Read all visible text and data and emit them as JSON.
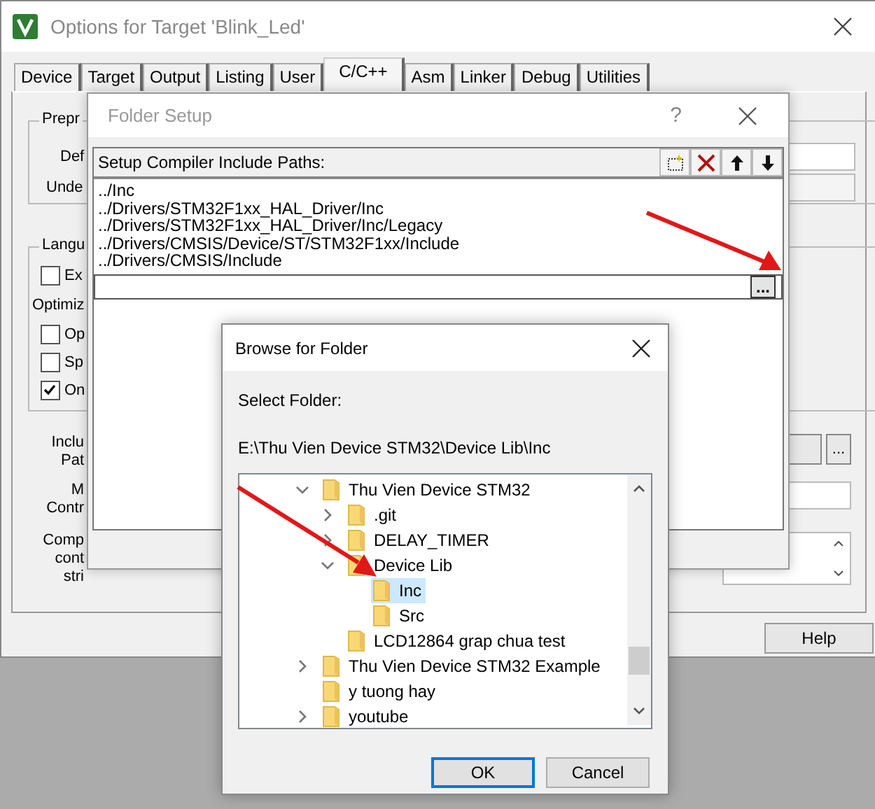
{
  "main_window": {
    "title": "Options for Target 'Blink_Led'",
    "tabs": [
      {
        "label": "Device",
        "selected": false
      },
      {
        "label": "Target",
        "selected": false
      },
      {
        "label": "Output",
        "selected": false
      },
      {
        "label": "Listing",
        "selected": false
      },
      {
        "label": "User",
        "selected": false
      },
      {
        "label": "C/C++",
        "selected": true
      },
      {
        "label": "Asm",
        "selected": false
      },
      {
        "label": "Linker",
        "selected": false
      },
      {
        "label": "Debug",
        "selected": false
      },
      {
        "label": "Utilities",
        "selected": false
      }
    ],
    "preprocessor_group": {
      "label": "Prepr",
      "fields": [
        {
          "label": "Def"
        },
        {
          "label": "Unde"
        }
      ]
    },
    "language_group": {
      "label": "Langu",
      "items": [
        {
          "kind": "checkbox",
          "label": "Ex",
          "checked": false
        },
        {
          "kind": "label",
          "label": "Optimiz"
        },
        {
          "kind": "checkbox",
          "label": "Op",
          "checked": false
        },
        {
          "kind": "checkbox",
          "label": "Sp",
          "checked": false
        },
        {
          "kind": "checkbox",
          "label": "On",
          "checked": true
        }
      ]
    },
    "include_paths_label": [
      "Inclu",
      "Pat"
    ],
    "include_paths_browse": "...",
    "misc_controls_label": [
      "M",
      "Contr"
    ],
    "compiler_string_label": [
      "Comp",
      "cont",
      "stri"
    ],
    "help_button": "Help"
  },
  "folder_setup": {
    "title": "Folder Setup",
    "help": "?",
    "header": "Setup Compiler Include Paths:",
    "paths": [
      "../Inc",
      "../Drivers/STM32F1xx_HAL_Driver/Inc",
      "../Drivers/STM32F1xx_HAL_Driver/Inc/Legacy",
      "../Drivers/CMSIS/Device/ST/STM32F1xx/Include",
      "../Drivers/CMSIS/Include"
    ],
    "browse_button": "..."
  },
  "browse_dialog": {
    "title": "Browse for Folder",
    "select_label": "Select Folder:",
    "path": "E:\\Thu Vien Device STM32\\Device Lib\\Inc",
    "tree": [
      {
        "label": "Thu Vien Device STM32",
        "expanded": true,
        "selected": false,
        "children": [
          {
            "label": ".git",
            "expanded": false,
            "selected": false
          },
          {
            "label": "DELAY_TIMER",
            "expanded": false,
            "selected": false
          },
          {
            "label": "Device Lib",
            "expanded": true,
            "selected": false,
            "children": [
              {
                "label": "Inc",
                "selected": true
              },
              {
                "label": "Src",
                "selected": false
              }
            ]
          },
          {
            "label": "LCD12864 grap chua test",
            "selected": false
          }
        ]
      },
      {
        "label": "Thu Vien Device STM32 Example",
        "expanded": false,
        "selected": false
      },
      {
        "label": "y tuong hay",
        "selected": false
      },
      {
        "label": "youtube",
        "expanded": false,
        "selected": false
      }
    ],
    "buttons": [
      {
        "label": "OK",
        "default": true
      },
      {
        "label": "Cancel",
        "default": false
      }
    ]
  }
}
